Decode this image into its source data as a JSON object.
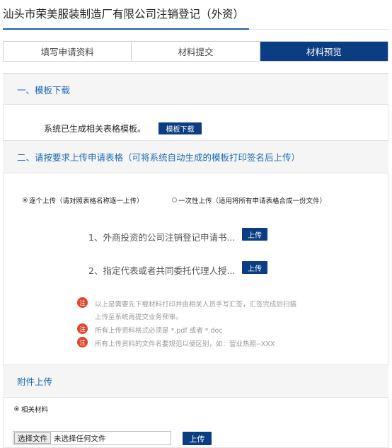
{
  "page": {
    "title": "汕头市荣美服装制造厂有限公司注销登记（外资）"
  },
  "steps": {
    "tabs": [
      "填写申请资料",
      "材料提交",
      "材料预览"
    ],
    "active_index": 2
  },
  "section_template": {
    "heading": "一、模板下载",
    "message": "系统已生成相关表格模板。",
    "download_button": "模板下载"
  },
  "section_upload": {
    "heading": "二、请按要求上传申请表格（可将系统自动生成的模板打印签名后上传）",
    "mode_one_by_one": "逐个上传（请对照表格名称逐一上传）",
    "mode_all_at_once": "一次性上传（适用将所有申请表格合成一份文件）",
    "selected_mode": "one_by_one",
    "items": [
      {
        "label": "1、外商投资的公司注销登记申请书...",
        "button": "上传"
      },
      {
        "label": "2、指定代表或者共同委托代理人授...",
        "button": "上传"
      }
    ],
    "note_icon_text": "注",
    "notes": {
      "line1": "以上是需要先下载材料打印并由相关人员手写汇签，汇签完成后扫描",
      "line1b": "上传至系统再提交业务预审。",
      "line2": "所有上传资料格式必须是 *.pdf 或者 *.doc",
      "line3": "所有上传资料的文件名要规范以便区别，如：营业热照--XXX"
    }
  },
  "section_attachment": {
    "heading": "附件上传",
    "radio_label": "相关材料",
    "choose_file_button": "选择文件",
    "no_file_text": "未选择任何文件",
    "upload_button": "上传"
  },
  "colors": {
    "accent": "#0a3d82",
    "link": "#1e6ab4",
    "note_icon": "#e2452b"
  }
}
